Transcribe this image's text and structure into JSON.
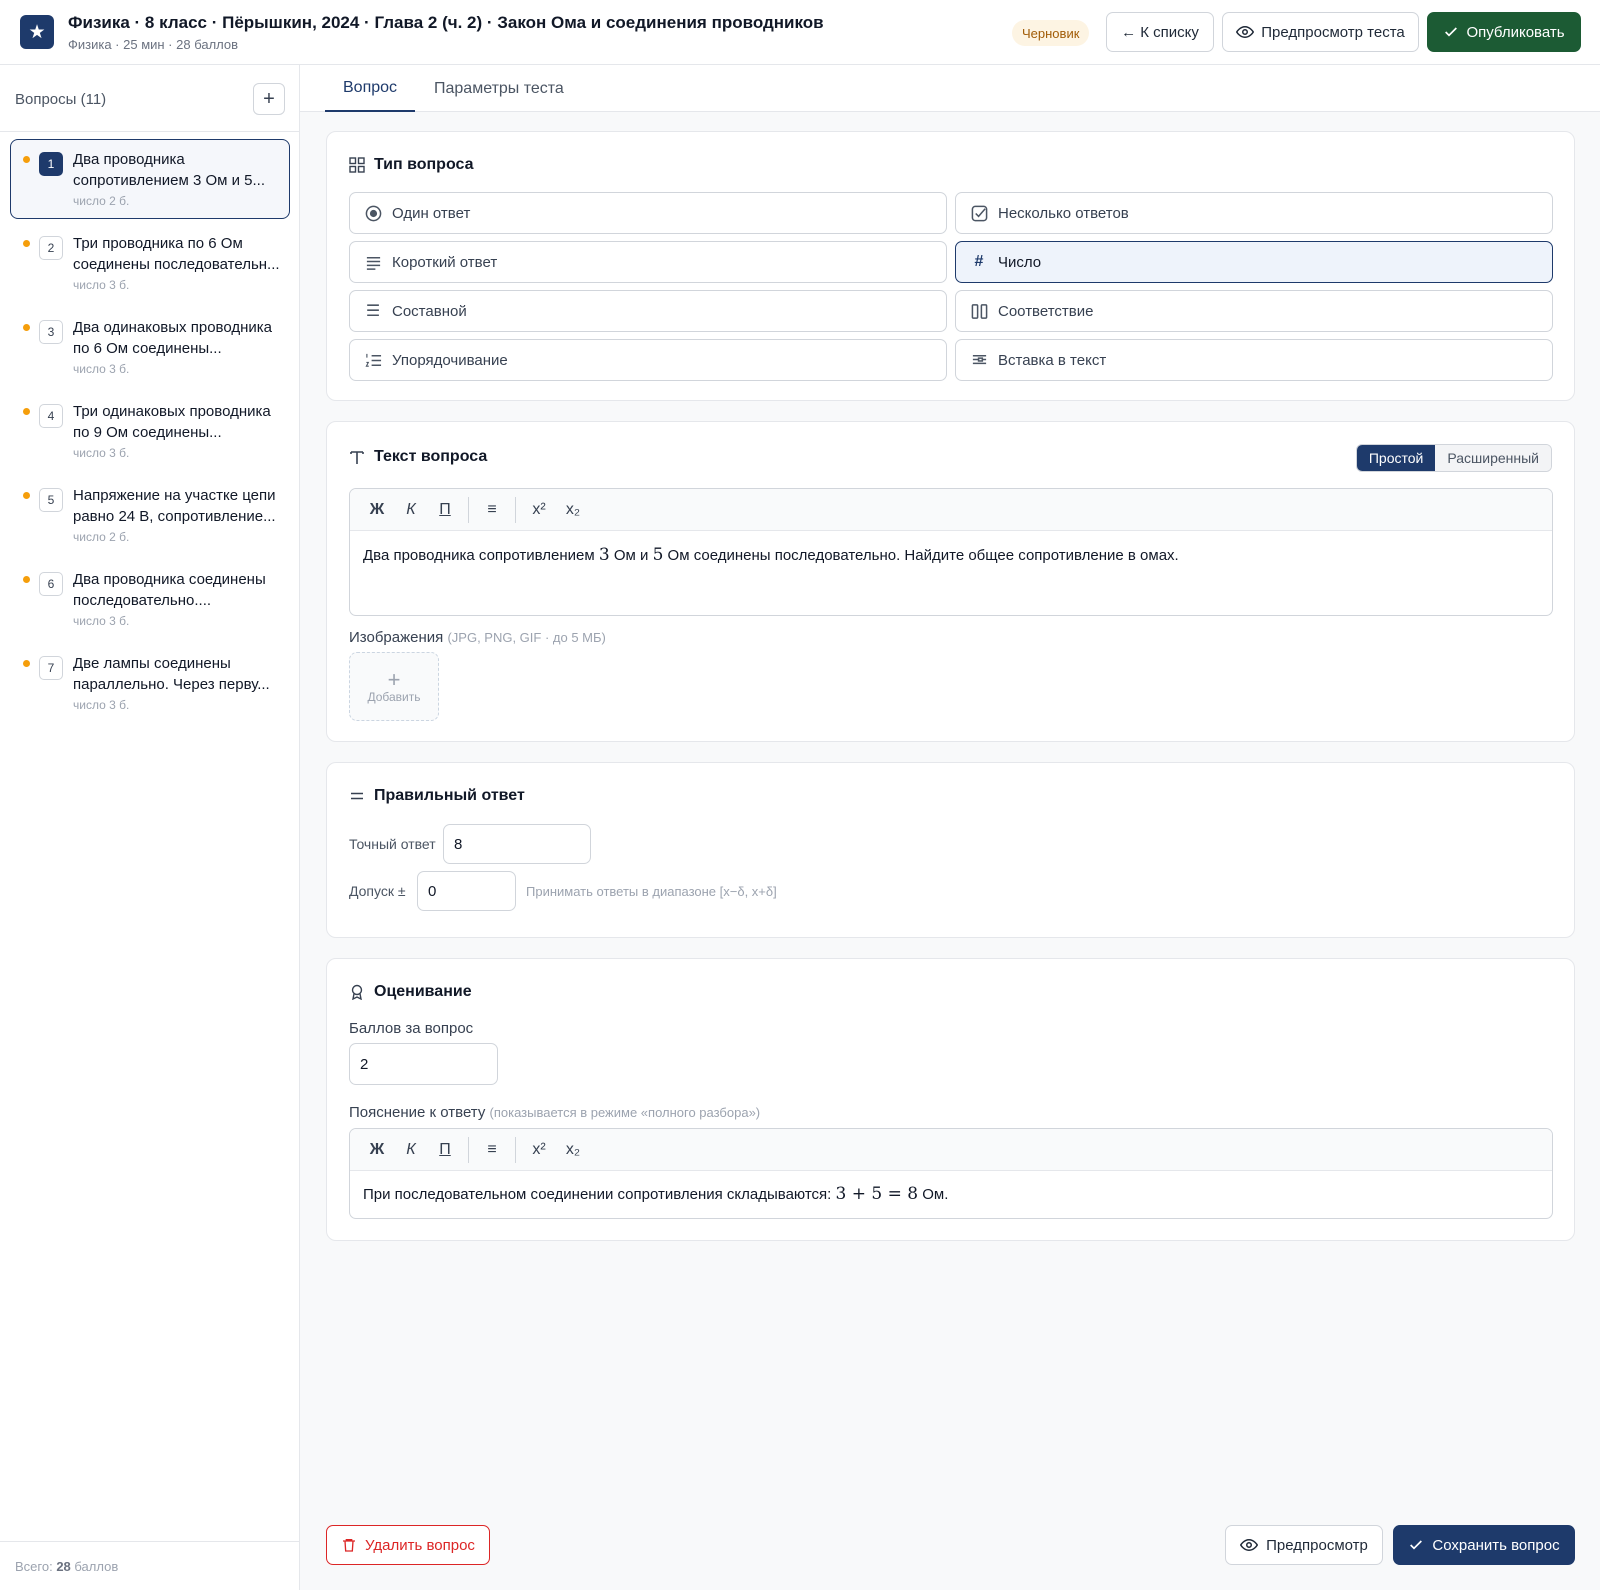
{
  "header": {
    "title": "Физика · 8 класс · Пёрышкин, 2024 · Глава 2 (ч. 2) · Закон Ома и соединения проводников",
    "subtitle": "Физика · 25 мин · 28 баллов",
    "status_badge": "Черновик",
    "back_label": "← К списку",
    "preview_test_label": "Предпросмотр теста",
    "publish_label": "Опубликовать"
  },
  "sidebar": {
    "title": "Вопросы (11)",
    "add_label": "+",
    "items": [
      {
        "num": "1",
        "text": "Два проводника сопротивлением 3 Ом и 5...",
        "meta": "число  2 б."
      },
      {
        "num": "2",
        "text": "Три проводника по 6 Ом соединены последовательн...",
        "meta": "число  3 б."
      },
      {
        "num": "3",
        "text": "Два одинаковых проводника по 6 Ом соединены...",
        "meta": "число  3 б."
      },
      {
        "num": "4",
        "text": "Три одинаковых проводника по 9 Ом соединены...",
        "meta": "число  3 б."
      },
      {
        "num": "5",
        "text": "Напряжение на участке цепи равно 24 В, сопротивление...",
        "meta": "число  2 б."
      },
      {
        "num": "6",
        "text": "Два проводника соединены последовательно....",
        "meta": "число  3 б."
      },
      {
        "num": "7",
        "text": "Две лампы соединены параллельно. Через перву...",
        "meta": "число  3 б."
      }
    ],
    "footer_prefix": "Всего: ",
    "footer_value": "28",
    "footer_suffix": " баллов"
  },
  "tabs": {
    "question": "Вопрос",
    "params": "Параметры теста"
  },
  "question_type": {
    "title": "Тип вопроса",
    "options": [
      {
        "label": "Один ответ",
        "icon": "radio-icon"
      },
      {
        "label": "Несколько ответов",
        "icon": "checkbox-icon"
      },
      {
        "label": "Короткий ответ",
        "icon": "lines-icon"
      },
      {
        "label": "Число",
        "icon": "hash-icon"
      },
      {
        "label": "Составной",
        "icon": "list-icon"
      },
      {
        "label": "Соответствие",
        "icon": "columns-icon"
      },
      {
        "label": "Упорядочивание",
        "icon": "ordered-list-icon"
      },
      {
        "label": "Вставка в текст",
        "icon": "text-insert-icon"
      }
    ],
    "selected": "Число"
  },
  "question_text": {
    "title": "Текст вопроса",
    "mode_simple": "Простой",
    "mode_advanced": "Расширенный",
    "toolbar": {
      "bold": "Ж",
      "italic": "К",
      "underline": "П",
      "list": "≡",
      "sup": "x²",
      "sub": "x₂"
    },
    "part1": "Два проводника сопротивлением ",
    "num1": "3",
    "part2": " Ом и ",
    "num2": "5",
    "part3": " Ом соединены последовательно. Найдите общее сопротивление в омах.",
    "images_label": "Изображения",
    "images_hint": "(JPG, PNG, GIF · до 5 МБ)",
    "add_image_label": "Добавить"
  },
  "correct_answer": {
    "title": "Правильный ответ",
    "exact_label": "Точный ответ",
    "exact_value": "8",
    "tolerance_label": "Допуск ±",
    "tolerance_value": "0",
    "range_hint": "Принимать ответы в диапазоне [x−δ, x+δ]"
  },
  "grading": {
    "title": "Оценивание",
    "points_label": "Баллов за вопрос",
    "points_value": "2",
    "explanation_label": "Пояснение к ответу",
    "explanation_hint": "(показывается в режиме «полного разбора»)",
    "explanation_text": "При последовательном соединении сопротивления складываются: ",
    "explanation_math": "3 + 5 = 8",
    "explanation_suffix": " Ом."
  },
  "footer_actions": {
    "delete_label": "Удалить вопрос",
    "preview_label": "Предпросмотр",
    "save_label": "Сохранить вопрос"
  },
  "colors": {
    "accent": "#1e3a6b",
    "publish": "#1c5b34",
    "danger": "#dc2626",
    "draft_badge": "#fdf4e3",
    "dot": "#f59e0b"
  }
}
